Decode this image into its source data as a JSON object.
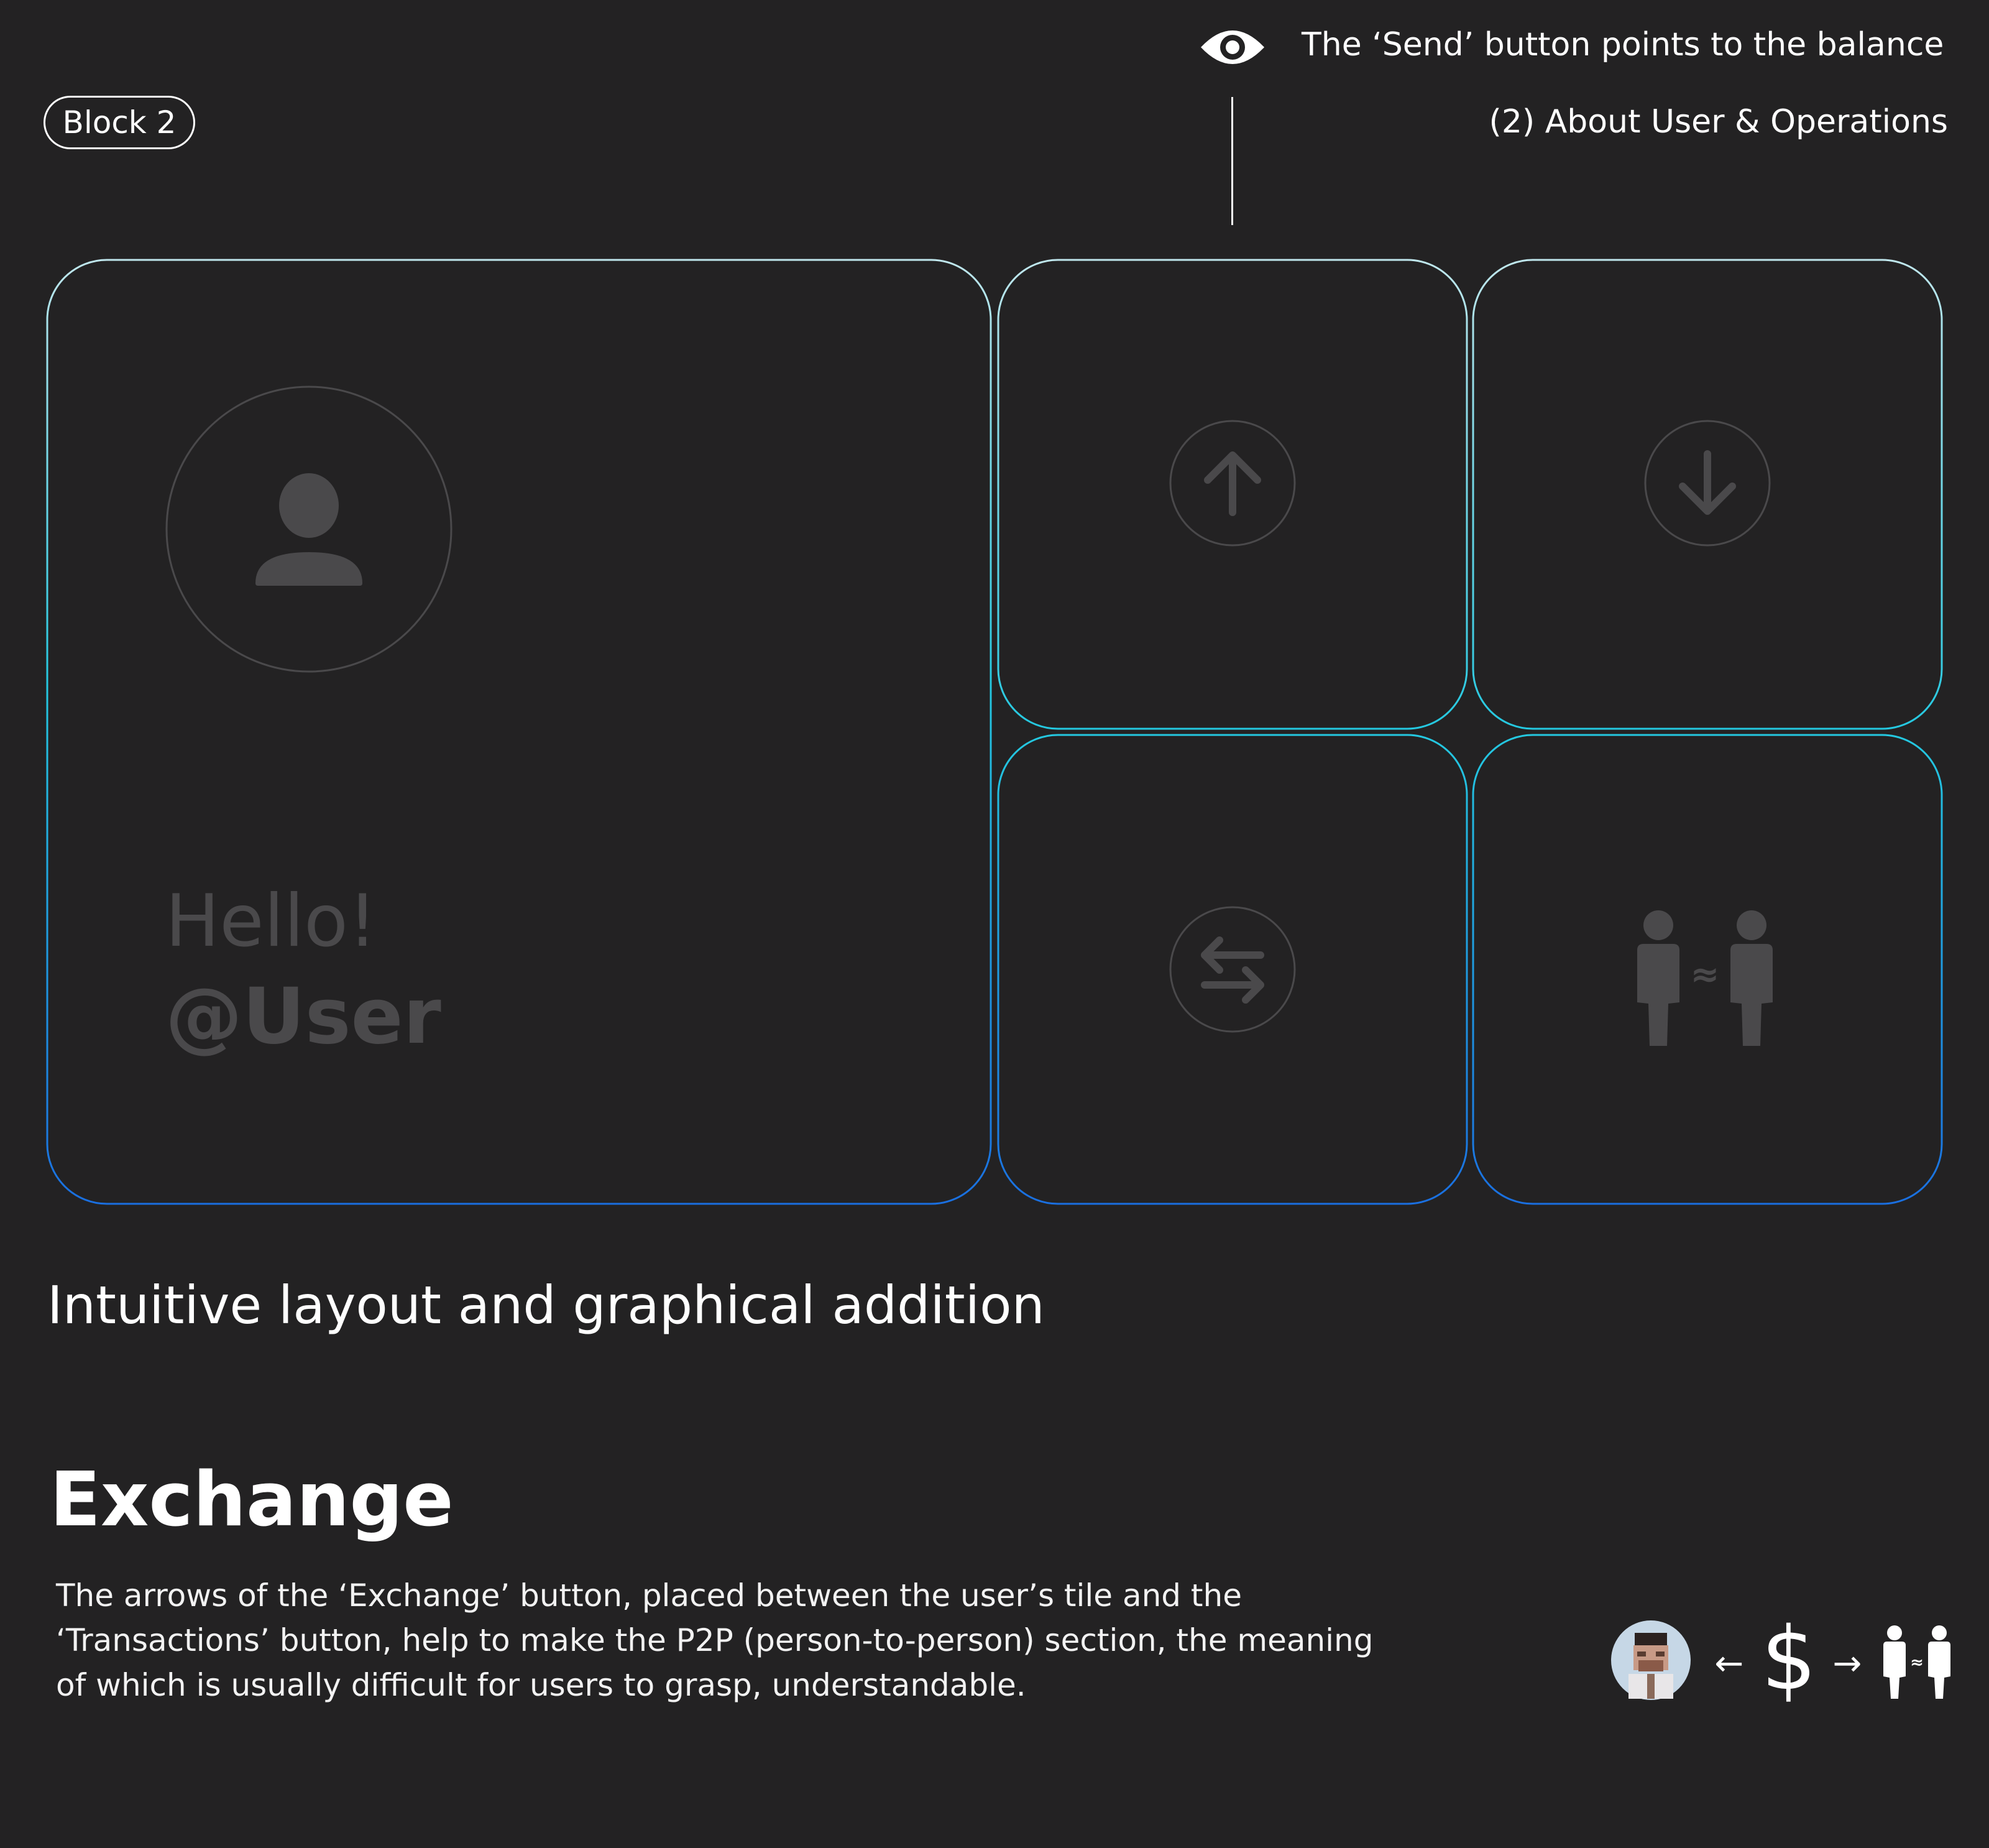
{
  "header": {
    "block_label": "Block 2",
    "eye_note": "The ‘Send’ button points to the balance",
    "section_note": "(2) About User & Operations"
  },
  "tiles": {
    "user_tile": {
      "greeting": "Hello!",
      "handle": "@User",
      "icon": "user-avatar-icon"
    },
    "send_tile": {
      "icon": "arrow-up-icon"
    },
    "receive_tile": {
      "icon": "arrow-down-icon"
    },
    "exchange_tile": {
      "icon": "swap-arrows-icon"
    },
    "p2p_tile": {
      "icon": "person-to-person-icon",
      "symbol": "≈"
    }
  },
  "tagline": "Intuitive layout and graphical addition",
  "exchange_section": {
    "title": "Exchange",
    "body_lines": [
      "The arrows of the ‘Exchange’ button, placed between the user’s tile and the",
      "‘Transactions’ button, help to make the P2P (person-to-person) section, the meaning",
      "of which is usually difficult for users to grasp, understandable."
    ]
  },
  "flow_diagram": {
    "left_arrow": "←",
    "currency": "$",
    "right_arrow": "→",
    "p2p_symbol": "≈"
  },
  "colors": {
    "background": "#232223",
    "tile_border_top": "#bfe6ec",
    "tile_border_mid": "#24c8e0",
    "tile_border_bottom": "#1a6fe0",
    "icon_gray": "#4a494b"
  }
}
